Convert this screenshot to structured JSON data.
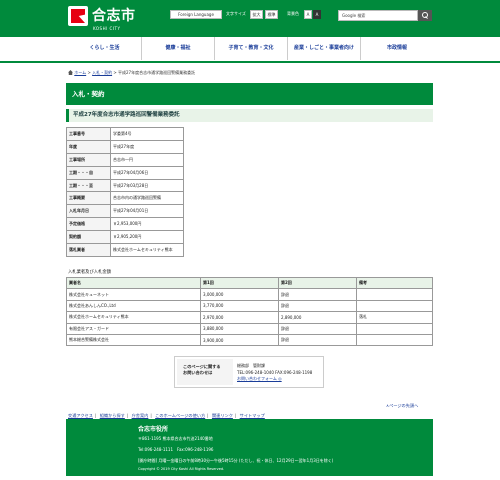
{
  "header": {
    "logo_title": "合志市",
    "logo_sub": "KOSHI CITY",
    "foreign_label": "Foreign Language",
    "font_size_label": "文字サイズ",
    "font_size_enlarge": "拡大",
    "font_size_standard": "標準",
    "bg_color_label": "背景色",
    "bg_a1": "A",
    "bg_a2": "A",
    "search_placeholder": "Google 検索"
  },
  "gnav": [
    {
      "label": "くらし・生活"
    },
    {
      "label": "健康・福祉"
    },
    {
      "label": "子育て・教育・文化"
    },
    {
      "label": "産業・しごと・事業者向け"
    },
    {
      "label": "市政情報"
    }
  ],
  "breadcrumb": {
    "home": "ホーム",
    "sep": ">",
    "level1": "入札・契約",
    "current": "平成27年度合志市通学路巡回警備業務委託"
  },
  "page_title": "入札・契約",
  "sub_title": "平成27年度合志市通学路巡回警備業務委託",
  "info_rows": [
    {
      "key": "工事番号",
      "value": "学委第4号"
    },
    {
      "key": "年度",
      "value": "平成27年度"
    },
    {
      "key": "工事場所",
      "value": "合志市一円"
    },
    {
      "key": "工期・・・自",
      "value": "平成27年04月06日"
    },
    {
      "key": "工期・・・至",
      "value": "平成27年03月28日"
    },
    {
      "key": "工事概要",
      "value": "合志市内の通学路巡回警備"
    },
    {
      "key": "入札年月日",
      "value": "平成27年04月01日"
    },
    {
      "key": "予定価格",
      "value": "￥2,953,000円"
    },
    {
      "key": "契約額",
      "value": "￥2,905,200円"
    },
    {
      "key": "落札業者",
      "value": "株式会社ホームセキュリティ熊本"
    }
  ],
  "bid_caption": "入札業者及び入札金額",
  "bid_headers": [
    "業者名",
    "第1回",
    "第2回",
    "備考"
  ],
  "bid_rows": [
    [
      "株式会社キューネット",
      "3,000,000",
      "辞退",
      ""
    ],
    [
      "株式会社あんしんCO.,Ltd",
      "3,770,000",
      "辞退",
      ""
    ],
    [
      "株式会社ホームセキュリティ熊本",
      "2,970,000",
      "2,890,000",
      "落札"
    ],
    [
      "有限会社アス・ガード",
      "3,880,000",
      "辞退",
      ""
    ],
    [
      "熊本総合警備株式会社",
      "3,900,000",
      "辞退",
      ""
    ]
  ],
  "contact": {
    "label1": "このページに関する",
    "label2": "お問い合わせは",
    "dept": "総務部　管財課",
    "tel": "TEL:096-248-1040 FAX:096-248-1198",
    "form_link": "お問い合わせフォーム ◎"
  },
  "page_top": "∧ページの先頭へ",
  "footnav": [
    "交通アクセス",
    "組織から探す",
    "庁舎案内",
    "このホームページの使い方",
    "関連リンク",
    "サイトマップ"
  ],
  "footer": {
    "title": "合志市役所",
    "address": "〒861-1195  熊本県合志市竹迫2140番地",
    "tel": "Tel:096-248-1111　Fax:096-248-1196",
    "hours": "[開庁時間] 月曜～金曜日の午前8時30分～午後5時15分 (ただし、祝・休日、12月29日～翌年1月3日を除く)",
    "copyright": "Copyright © 2019 City Koshi All Rights Reserved."
  }
}
